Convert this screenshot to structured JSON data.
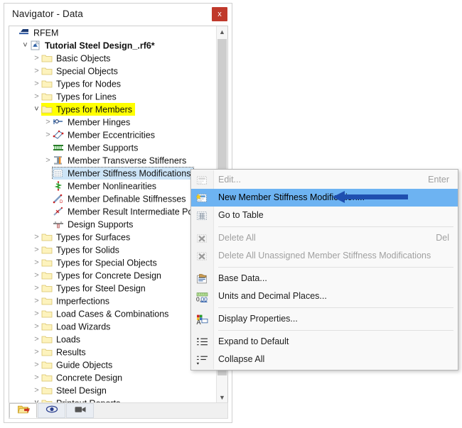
{
  "window": {
    "title": "Navigator - Data",
    "close_label": "x"
  },
  "tree": {
    "rows": [
      {
        "label": "RFEM",
        "indent": 0,
        "chevron": "none",
        "icon": "rfem-logo-icon",
        "bold": false,
        "state": "normal"
      },
      {
        "label": "Tutorial Steel Design_.rf6*",
        "indent": 1,
        "chevron": "open",
        "icon": "model-file-icon",
        "bold": true,
        "state": "normal"
      },
      {
        "label": "Basic Objects",
        "indent": 2,
        "chevron": "closed",
        "icon": "folder-icon",
        "bold": false,
        "state": "normal"
      },
      {
        "label": "Special Objects",
        "indent": 2,
        "chevron": "closed",
        "icon": "folder-icon",
        "bold": false,
        "state": "normal"
      },
      {
        "label": "Types for Nodes",
        "indent": 2,
        "chevron": "closed",
        "icon": "folder-icon",
        "bold": false,
        "state": "normal"
      },
      {
        "label": "Types for Lines",
        "indent": 2,
        "chevron": "closed",
        "icon": "folder-icon",
        "bold": false,
        "state": "normal"
      },
      {
        "label": "Types for Members",
        "indent": 2,
        "chevron": "open",
        "icon": "folder-icon",
        "bold": false,
        "state": "highlight-yellow"
      },
      {
        "label": "Member Hinges",
        "indent": 3,
        "chevron": "closed",
        "icon": "member-hinge-icon",
        "bold": false,
        "state": "normal"
      },
      {
        "label": "Member Eccentricities",
        "indent": 3,
        "chevron": "closed",
        "icon": "member-eccentricity-icon",
        "bold": false,
        "state": "normal"
      },
      {
        "label": "Member Supports",
        "indent": 3,
        "chevron": "none",
        "icon": "member-support-icon",
        "bold": false,
        "state": "normal"
      },
      {
        "label": "Member Transverse Stiffeners",
        "indent": 3,
        "chevron": "closed",
        "icon": "member-transverse-stiffener-icon",
        "bold": false,
        "state": "normal"
      },
      {
        "label": "Member Stiffness Modifications",
        "indent": 3,
        "chevron": "none",
        "icon": "member-stiffness-modification-icon",
        "bold": false,
        "state": "selected"
      },
      {
        "label": "Member Nonlinearities",
        "indent": 3,
        "chevron": "none",
        "icon": "member-nonlinearity-icon",
        "bold": false,
        "state": "normal"
      },
      {
        "label": "Member Definable Stiffnesses",
        "indent": 3,
        "chevron": "none",
        "icon": "member-definable-stiffness-icon",
        "bold": false,
        "state": "normal"
      },
      {
        "label": "Member Result Intermediate Points",
        "indent": 3,
        "chevron": "none",
        "icon": "member-result-intermediate-point-icon",
        "bold": false,
        "state": "normal"
      },
      {
        "label": "Design Supports",
        "indent": 3,
        "chevron": "none",
        "icon": "design-support-icon",
        "bold": false,
        "state": "normal"
      },
      {
        "label": "Types for Surfaces",
        "indent": 2,
        "chevron": "closed",
        "icon": "folder-icon",
        "bold": false,
        "state": "normal"
      },
      {
        "label": "Types for Solids",
        "indent": 2,
        "chevron": "closed",
        "icon": "folder-icon",
        "bold": false,
        "state": "normal"
      },
      {
        "label": "Types for Special Objects",
        "indent": 2,
        "chevron": "closed",
        "icon": "folder-icon",
        "bold": false,
        "state": "normal"
      },
      {
        "label": "Types for Concrete Design",
        "indent": 2,
        "chevron": "closed",
        "icon": "folder-icon",
        "bold": false,
        "state": "normal"
      },
      {
        "label": "Types for Steel Design",
        "indent": 2,
        "chevron": "closed",
        "icon": "folder-icon",
        "bold": false,
        "state": "normal"
      },
      {
        "label": "Imperfections",
        "indent": 2,
        "chevron": "closed",
        "icon": "folder-icon",
        "bold": false,
        "state": "normal"
      },
      {
        "label": "Load Cases & Combinations",
        "indent": 2,
        "chevron": "closed",
        "icon": "folder-icon",
        "bold": false,
        "state": "normal"
      },
      {
        "label": "Load Wizards",
        "indent": 2,
        "chevron": "closed",
        "icon": "folder-icon",
        "bold": false,
        "state": "normal"
      },
      {
        "label": "Loads",
        "indent": 2,
        "chevron": "closed",
        "icon": "folder-icon",
        "bold": false,
        "state": "normal"
      },
      {
        "label": "Results",
        "indent": 2,
        "chevron": "closed",
        "icon": "folder-icon",
        "bold": false,
        "state": "normal"
      },
      {
        "label": "Guide Objects",
        "indent": 2,
        "chevron": "closed",
        "icon": "folder-icon",
        "bold": false,
        "state": "normal"
      },
      {
        "label": "Concrete Design",
        "indent": 2,
        "chevron": "closed",
        "icon": "folder-icon",
        "bold": false,
        "state": "normal"
      },
      {
        "label": "Steel Design",
        "indent": 2,
        "chevron": "closed",
        "icon": "folder-icon",
        "bold": false,
        "state": "normal"
      },
      {
        "label": "Printout Reports",
        "indent": 2,
        "chevron": "open",
        "icon": "folder-icon",
        "bold": false,
        "state": "normal"
      }
    ]
  },
  "bottom_toolbar": {
    "buttons": [
      {
        "name": "navigator-data-tab",
        "icon": "folder-open-icon",
        "active": true
      },
      {
        "name": "navigator-display-tab",
        "icon": "eye-icon",
        "active": false
      },
      {
        "name": "navigator-views-tab",
        "icon": "camera-icon",
        "active": false
      }
    ]
  },
  "context_menu": {
    "items": [
      {
        "label": "Edit...",
        "accel": "Enter",
        "icon": "edit-stiffness-icon",
        "disabled": true,
        "highlight": false,
        "separator_after": false
      },
      {
        "label": "New Member Stiffness Modification...",
        "accel": "",
        "icon": "new-stiffness-icon",
        "disabled": false,
        "highlight": true,
        "separator_after": false
      },
      {
        "label": "Go to Table",
        "accel": "",
        "icon": "go-to-table-icon",
        "disabled": false,
        "highlight": false,
        "separator_after": true
      },
      {
        "label": "Delete All",
        "accel": "Del",
        "icon": "delete-all-icon",
        "disabled": true,
        "highlight": false,
        "separator_after": false
      },
      {
        "label": "Delete All Unassigned Member Stiffness Modifications",
        "accel": "",
        "icon": "delete-unassigned-icon",
        "disabled": true,
        "highlight": false,
        "separator_after": true
      },
      {
        "label": "Base Data...",
        "accel": "",
        "icon": "base-data-icon",
        "disabled": false,
        "highlight": false,
        "separator_after": false
      },
      {
        "label": "Units and Decimal Places...",
        "accel": "",
        "icon": "units-decimal-places-icon",
        "disabled": false,
        "highlight": false,
        "separator_after": true
      },
      {
        "label": "Display Properties...",
        "accel": "",
        "icon": "display-properties-icon",
        "disabled": false,
        "highlight": false,
        "separator_after": true
      },
      {
        "label": "Expand to Default",
        "accel": "",
        "icon": "expand-icon",
        "disabled": false,
        "highlight": false,
        "separator_after": false
      },
      {
        "label": "Collapse All",
        "accel": "",
        "icon": "collapse-icon",
        "disabled": false,
        "highlight": false,
        "separator_after": false
      }
    ]
  },
  "annotation": {
    "arrow": "blue-left-arrow",
    "color": "#1f4fb0"
  },
  "colors": {
    "highlight_row": "#6db3f2",
    "selection": "#cce4f7",
    "marker_yellow": "#ffff00",
    "close_button": "#c0392b",
    "folder": "#fdf0ae"
  }
}
